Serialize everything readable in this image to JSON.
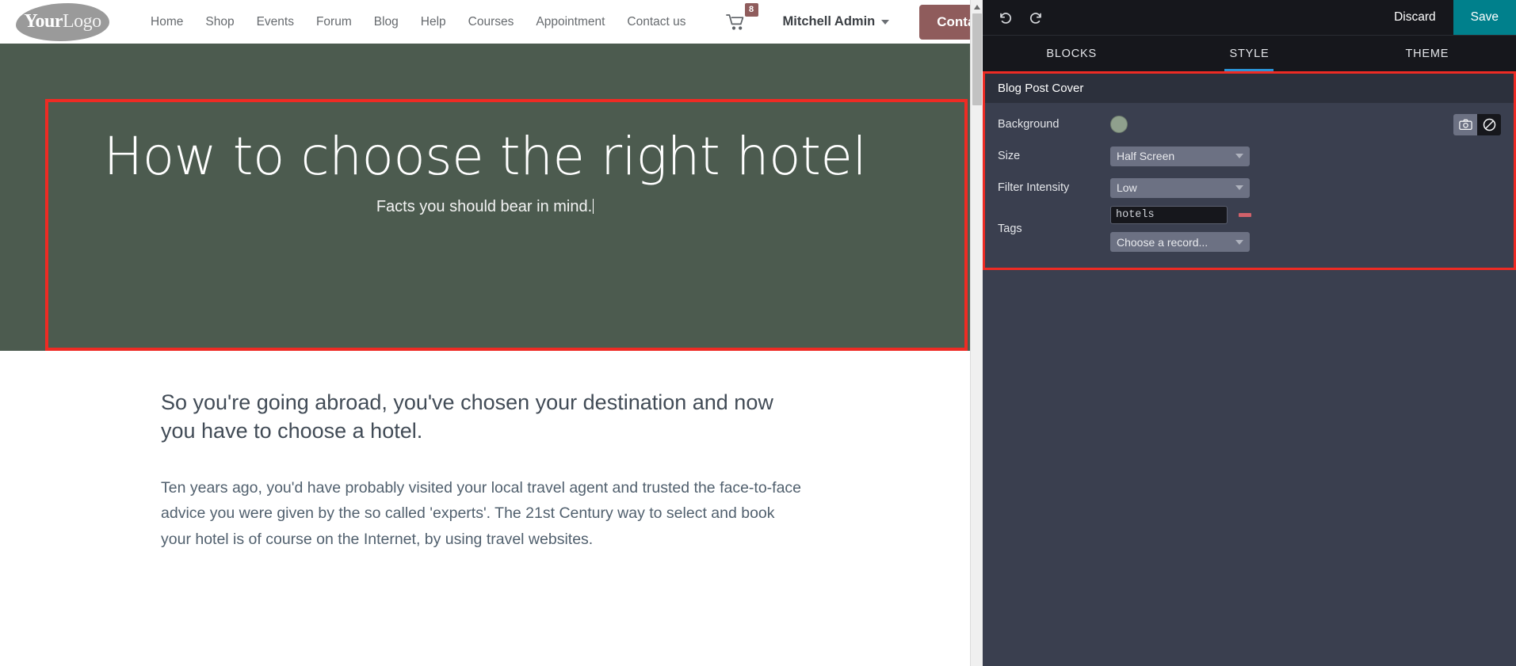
{
  "website": {
    "logo": {
      "bold": "Your",
      "light": "Logo"
    },
    "nav_items": [
      {
        "label": "Home"
      },
      {
        "label": "Shop"
      },
      {
        "label": "Events"
      },
      {
        "label": "Forum"
      },
      {
        "label": "Blog"
      },
      {
        "label": "Help"
      },
      {
        "label": "Courses"
      },
      {
        "label": "Appointment"
      },
      {
        "label": "Contact us"
      }
    ],
    "cart": {
      "icon": "cart-icon",
      "count": "8"
    },
    "user": {
      "name": "Mitchell Admin"
    },
    "cta": {
      "label": "Contact Us",
      "color": "#8f5c5c"
    },
    "cover": {
      "title": "How to choose the right hotel",
      "subtitle": "Facts you should bear in mind.",
      "background_color": "#4c5b4f",
      "selection_color": "#ee2b24"
    },
    "article": {
      "lead": "So you're going abroad, you've chosen your destination and now you have to choose a hotel.",
      "paragraph_1": "Ten years ago, you'd have probably visited your local travel agent and trusted the face-to-face advice you were given by the so called 'experts'. The 21st Century way to select and book your hotel is of course on the Internet, by using travel websites."
    }
  },
  "editor": {
    "topbar": {
      "undo_icon": "undo-icon",
      "redo_icon": "redo-icon",
      "discard_label": "Discard",
      "save_label": "Save",
      "save_color": "#00808c"
    },
    "tabs": [
      {
        "label": "BLOCKS",
        "active": false
      },
      {
        "label": "STYLE",
        "active": true
      },
      {
        "label": "THEME",
        "active": false
      }
    ],
    "options": {
      "title": "Blog Post Cover",
      "highlight_color": "#ee2b24",
      "rows": {
        "background": {
          "label": "Background",
          "swatch_color": "#8fa08d",
          "image_button_icon": "camera-icon",
          "none_button_icon": "no-image-icon"
        },
        "size": {
          "label": "Size",
          "value": "Half Screen"
        },
        "filter_intensity": {
          "label": "Filter Intensity",
          "value": "Low"
        },
        "tags": {
          "label": "Tags",
          "value": "hotels",
          "remove_icon": "minus-icon",
          "picker_placeholder": "Choose a record..."
        }
      }
    }
  }
}
